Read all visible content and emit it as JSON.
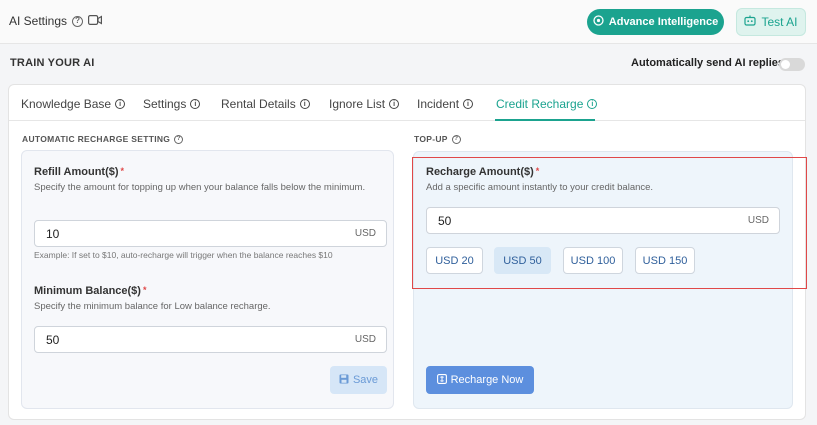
{
  "header": {
    "title": "AI Settings",
    "advance_label": "Advance Intelligence",
    "test_label": "Test AI"
  },
  "train": {
    "heading": "TRAIN YOUR AI",
    "auto_reply_label": "Automatically send AI replies",
    "auto_reply_enabled": false
  },
  "tabs": [
    {
      "label": "Knowledge Base"
    },
    {
      "label": "Settings"
    },
    {
      "label": "Rental Details"
    },
    {
      "label": "Ignore List"
    },
    {
      "label": "Incident"
    },
    {
      "label": "Credit Recharge",
      "active": true
    }
  ],
  "auto_recharge": {
    "section_title": "AUTOMATIC RECHARGE SETTING",
    "refill_label": "Refill Amount($)",
    "refill_desc": "Specify the amount for topping up when your balance falls below the minimum.",
    "refill_value": "10",
    "refill_unit": "USD",
    "refill_hint": "Example: If set to $10, auto-recharge will trigger when the balance reaches $10",
    "min_label": "Minimum Balance($)",
    "min_desc": "Specify the minimum balance for Low balance recharge.",
    "min_value": "50",
    "min_unit": "USD",
    "save_label": "Save"
  },
  "topup": {
    "section_title": "TOP-UP",
    "amount_label": "Recharge Amount($)",
    "amount_desc": "Add a specific amount instantly to your credit balance.",
    "amount_value": "50",
    "amount_unit": "USD",
    "presets": [
      {
        "label": "USD 20",
        "selected": false
      },
      {
        "label": "USD 50",
        "selected": true
      },
      {
        "label": "USD 100",
        "selected": false
      },
      {
        "label": "USD 150",
        "selected": false
      }
    ],
    "recharge_label": "Recharge Now"
  },
  "colors": {
    "accent": "#1ba38f",
    "primary_button": "#5c8fde",
    "highlight": "#e04848"
  }
}
